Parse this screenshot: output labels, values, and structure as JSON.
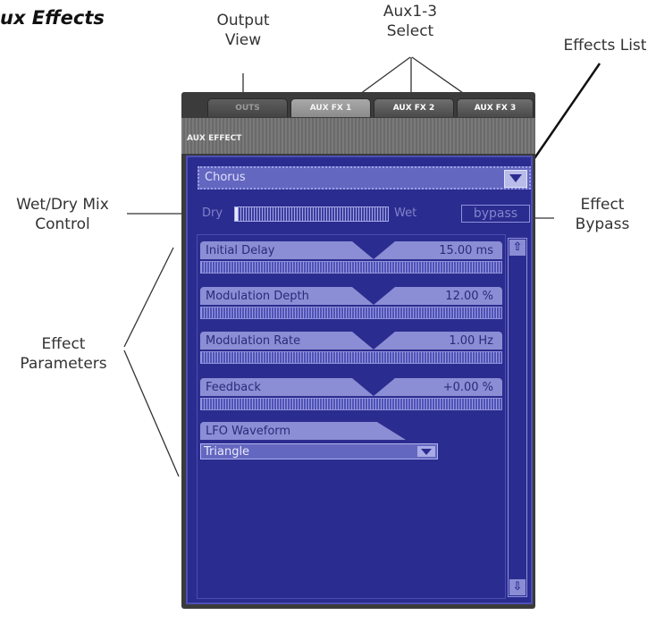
{
  "heading": "ux Effects",
  "annotations": {
    "output_view": [
      "Output",
      "View"
    ],
    "aux_select": [
      "Aux1-3",
      "Select"
    ],
    "effects_list": "Effects List",
    "wet_dry": [
      "Wet/Dry Mix",
      "Control"
    ],
    "effect_bypass": [
      "Effect",
      "Bypass"
    ],
    "effect_parameters": [
      "Effect",
      "Parameters"
    ]
  },
  "tabs": [
    "OUTS",
    "AUX FX 1",
    "AUX FX 2",
    "AUX FX 3"
  ],
  "section_label": "AUX EFFECT",
  "effect": {
    "selected": "Chorus",
    "dry_label": "Dry",
    "wet_label": "Wet",
    "bypass_label": "bypass",
    "mix_fraction": 0.0
  },
  "parameters": [
    {
      "name": "Initial Delay",
      "value": "15.00 ms"
    },
    {
      "name": "Modulation Depth",
      "value": "12.00 %"
    },
    {
      "name": "Modulation Rate",
      "value": "1.00 Hz"
    },
    {
      "name": "Feedback",
      "value": "+0.00 %"
    }
  ],
  "lfo": {
    "name": "LFO Waveform",
    "value": "Triangle"
  },
  "icons": {
    "effects_dropdown": "chevron-down-icon",
    "scroll_up": "arrow-up-icon",
    "scroll_down": "arrow-down-icon"
  },
  "colors": {
    "panel_blue": "#2b2c8f",
    "slider_blue": "#8b8ed4"
  }
}
